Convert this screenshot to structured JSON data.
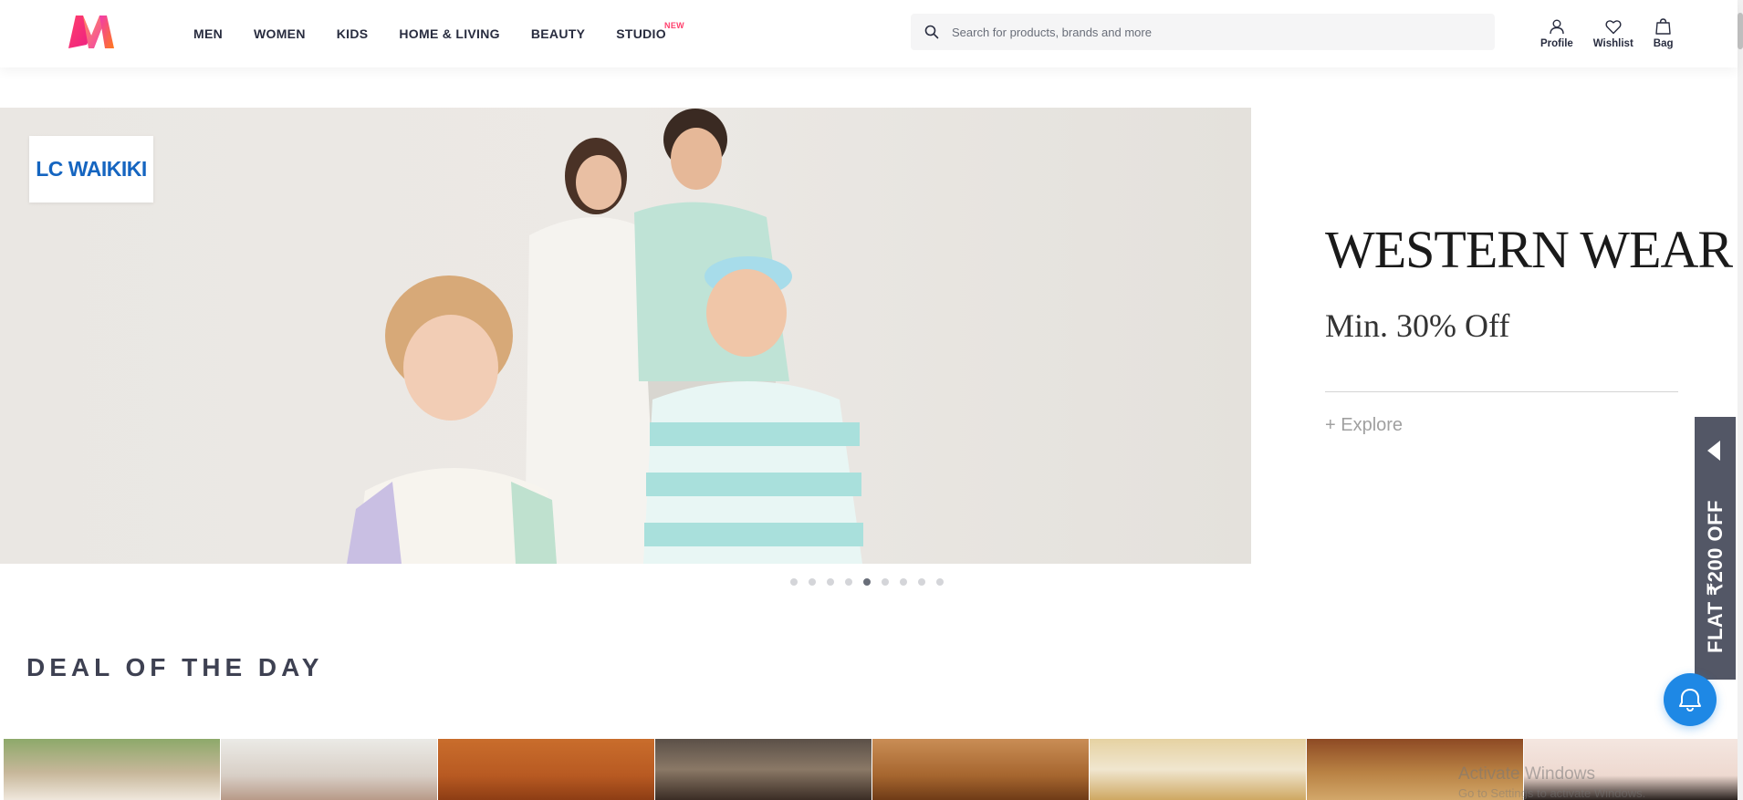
{
  "header": {
    "nav": [
      {
        "label": "MEN"
      },
      {
        "label": "WOMEN"
      },
      {
        "label": "KIDS"
      },
      {
        "label": "HOME & LIVING"
      },
      {
        "label": "BEAUTY"
      },
      {
        "label": "STUDIO",
        "badge": "NEW"
      }
    ],
    "search": {
      "placeholder": "Search for products, brands and more",
      "value": ""
    },
    "actions": [
      {
        "label": "Profile",
        "icon": "user-icon"
      },
      {
        "label": "Wishlist",
        "icon": "heart-icon"
      },
      {
        "label": "Bag",
        "icon": "bag-icon"
      }
    ],
    "logo_icon": "myntra-logo"
  },
  "hero": {
    "brand": "LC WAIKIKI",
    "title": "WESTERN WEAR",
    "subtitle": "Min. 30% Off",
    "cta": "+ Explore",
    "slide_count": 9,
    "active_slide": 5
  },
  "offer_tab": {
    "text": "FLAT ₹200 OFF"
  },
  "deal": {
    "title": "DEAL OF THE DAY"
  },
  "watermark": {
    "line1": "Activate Windows",
    "line2": "Go to Settings to activate Windows."
  },
  "colors": {
    "brand_pink": "#ff3f6c",
    "text_dark": "#282c3f",
    "offer_tab": "#535766",
    "chat": "#1e88e5"
  }
}
